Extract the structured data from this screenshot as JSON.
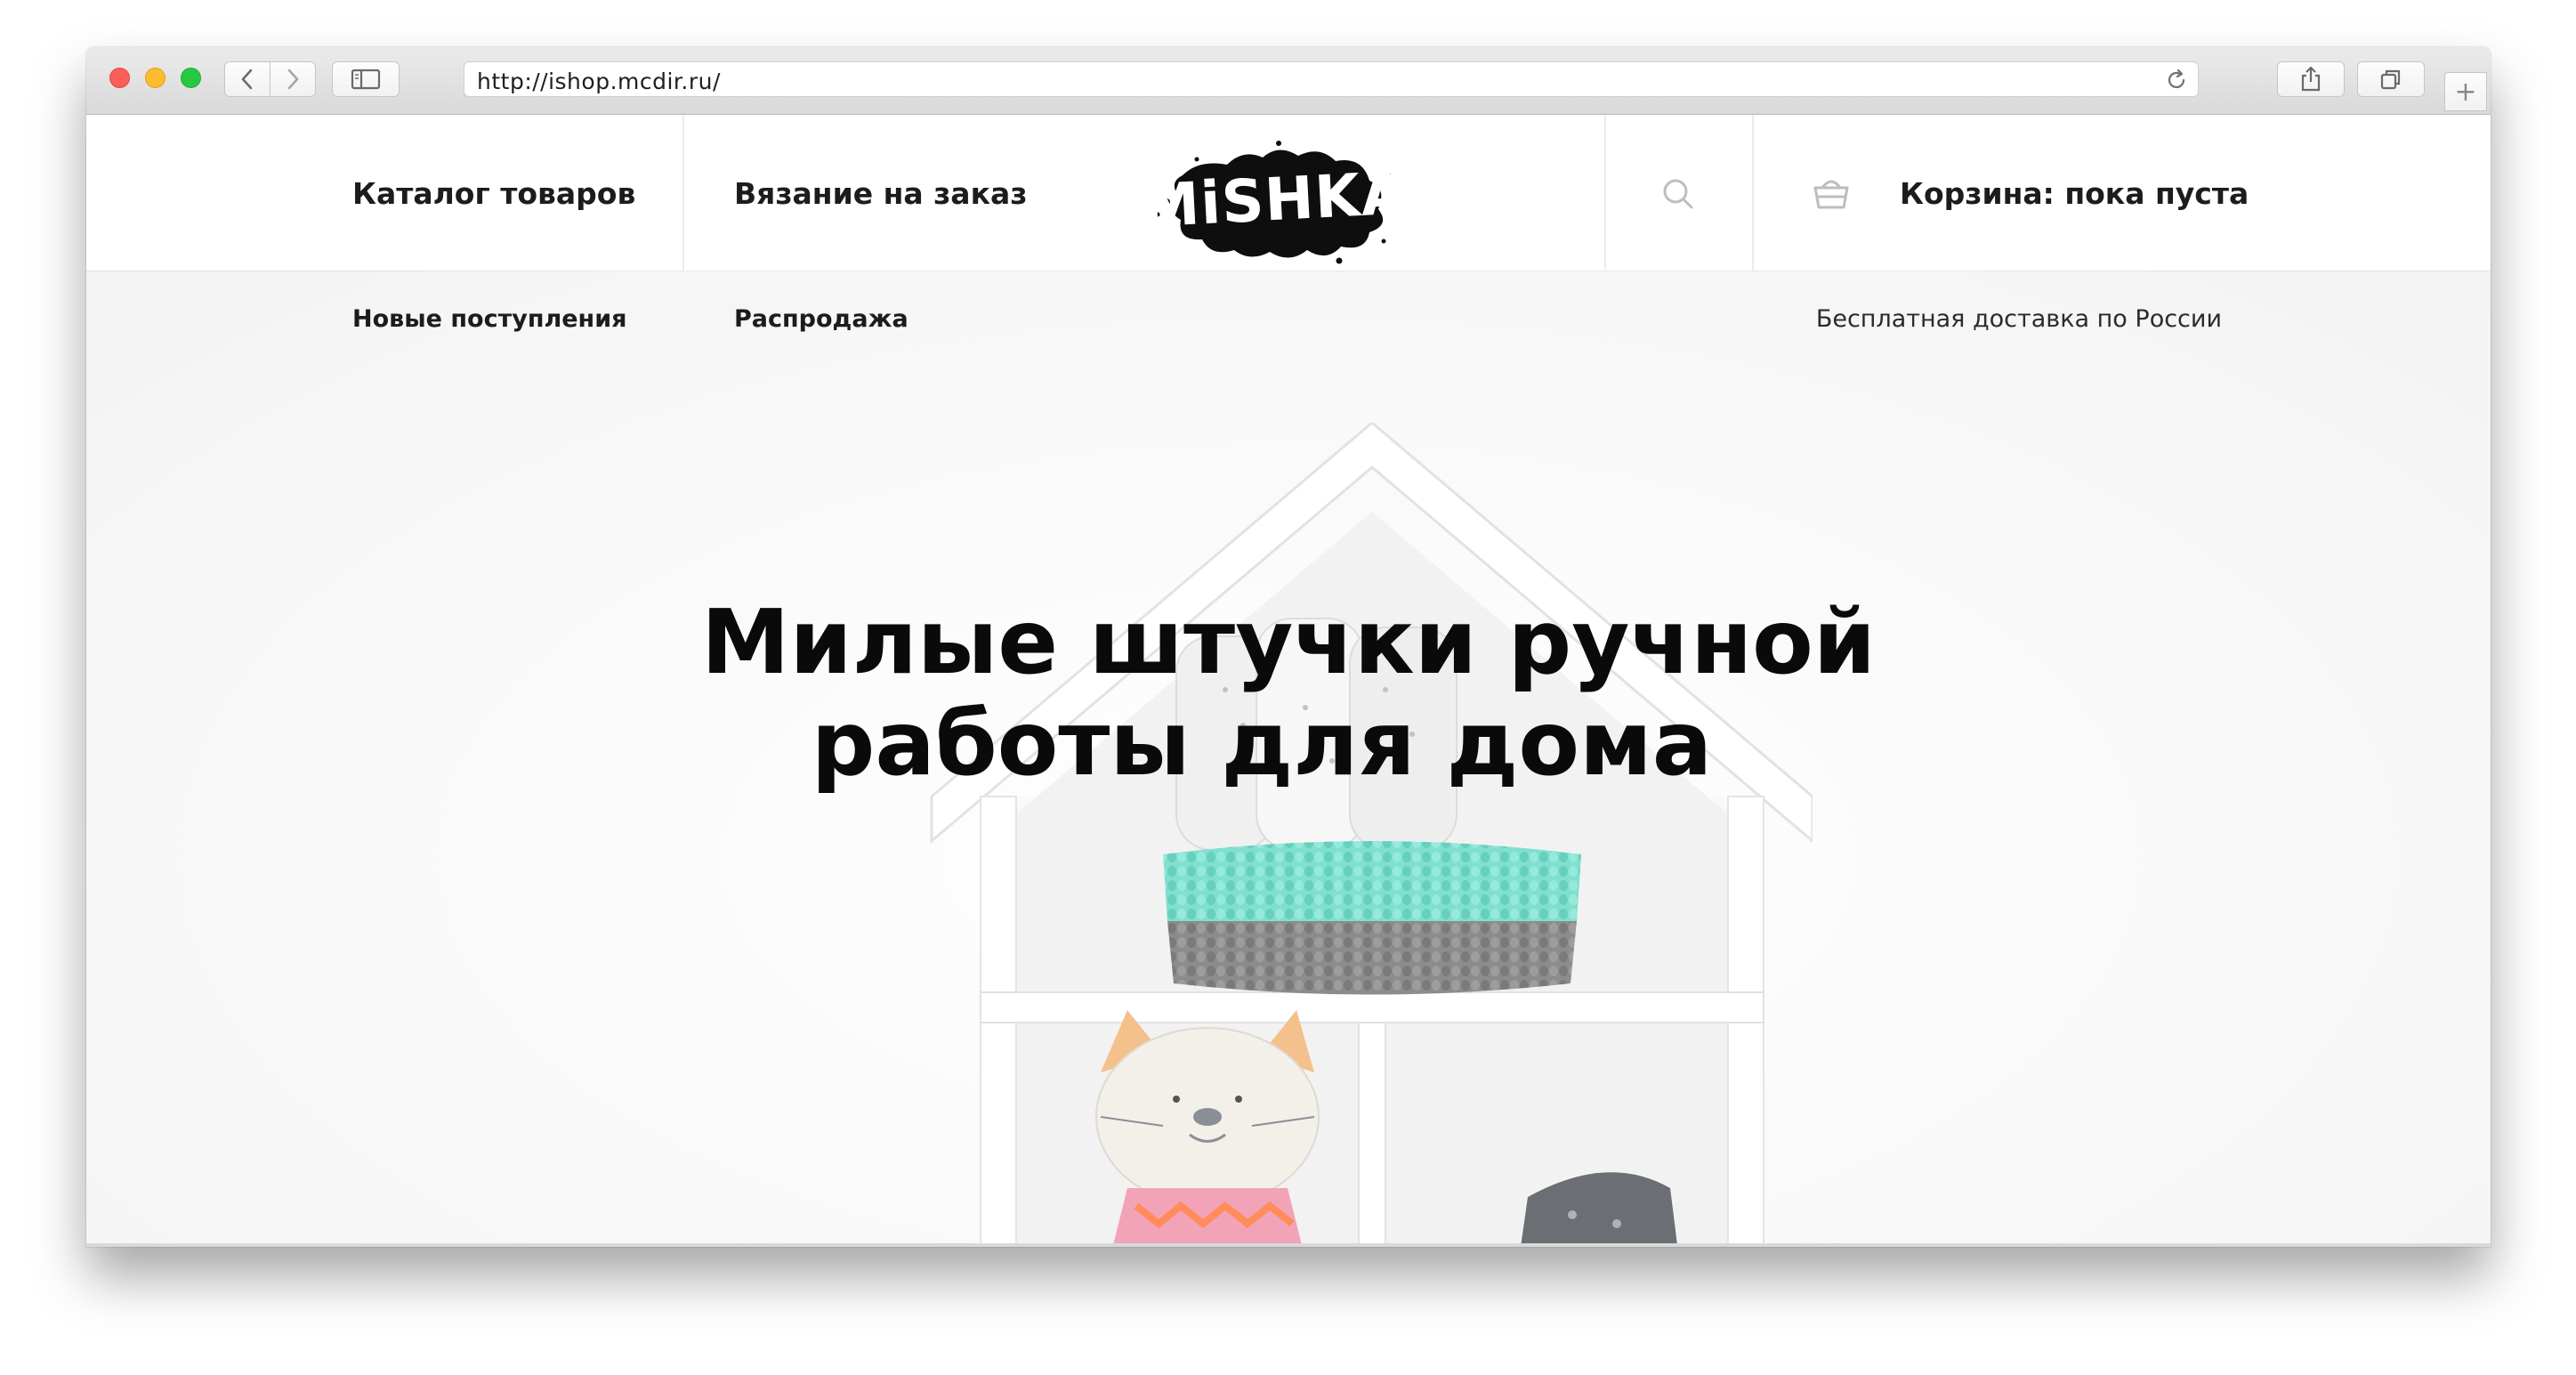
{
  "browser": {
    "url": "http://ishop.mcdir.ru/",
    "new_tab_glyph": "+",
    "icons": [
      "chevron-left-icon",
      "chevron-right-icon",
      "sidebar-icon",
      "reload-icon",
      "share-icon",
      "tabs-icon"
    ]
  },
  "header": {
    "nav": {
      "catalog": "Каталог товаров",
      "knitting": "Вязание на заказ"
    },
    "logo_text": "MiSHKA",
    "cart_label": "Корзина: пока пуста"
  },
  "subnav": {
    "new_arrivals": "Новые поступления",
    "sale": "Распродажа",
    "delivery": "Бесплатная доставка по России"
  },
  "hero": {
    "title_line1": "Милые штучки ручной",
    "title_line2": "работы для дома"
  },
  "colors": {
    "traffic_red": "#fc5f57",
    "traffic_yellow": "#fdbc2e",
    "traffic_green": "#28c840",
    "text": "#1c1c1c",
    "basket_mint": "#7fe0cf",
    "basket_gray": "#8c8c8c"
  }
}
